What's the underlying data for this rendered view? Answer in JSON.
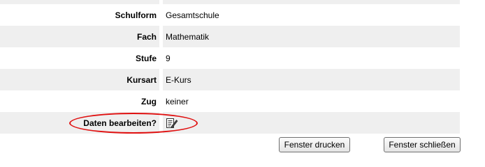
{
  "rows": [
    {
      "label": "Schulform",
      "value": "Gesamtschule"
    },
    {
      "label": "Fach",
      "value": "Mathematik"
    },
    {
      "label": "Stufe",
      "value": "9"
    },
    {
      "label": "Kursart",
      "value": "E-Kurs"
    },
    {
      "label": "Zug",
      "value": "keiner"
    },
    {
      "label": "Daten bearbeiten?",
      "icon": "edit-icon"
    }
  ],
  "buttons": {
    "print": "Fenster drucken",
    "close": "Fenster schließen"
  },
  "colors": {
    "row_alt": "#efefef",
    "highlight": "#e01010"
  }
}
